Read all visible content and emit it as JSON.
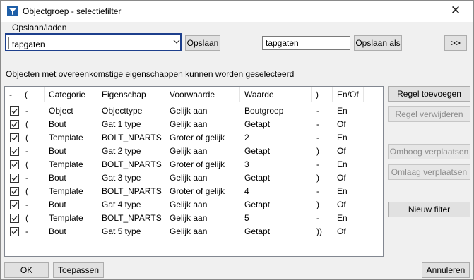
{
  "window": {
    "title": "Objectgroep - selectiefilter",
    "close_glyph": "✕"
  },
  "save_load": {
    "group_label": "Opslaan/laden",
    "combo_value": "tapgaten",
    "save_label": "Opslaan",
    "save_as_value": "tapgaten",
    "save_as_label": "Opslaan als",
    "more_label": ">>"
  },
  "info_text": "Objecten met overeenkomstige eigenschappen kunnen worden geselecteerd",
  "table": {
    "headers": [
      "-",
      "(",
      "Categorie",
      "Eigenschap",
      "Voorwaarde",
      "Waarde",
      ")",
      "En/Of"
    ],
    "rows": [
      {
        "checked": true,
        "dash": "-",
        "open": "-",
        "categorie": "Object",
        "eigenschap": "Objecttype",
        "voorwaarde": "Gelijk aan",
        "waarde": "Boutgroep",
        "close": "-",
        "enof": "En"
      },
      {
        "checked": true,
        "dash": "-",
        "open": "(",
        "categorie": "Bout",
        "eigenschap": "Gat 1 type",
        "voorwaarde": "Gelijk aan",
        "waarde": "Getapt",
        "close": "-",
        "enof": "Of"
      },
      {
        "checked": true,
        "dash": "-",
        "open": "(",
        "categorie": "Template",
        "eigenschap": "BOLT_NPARTS",
        "voorwaarde": "Groter of gelijk",
        "waarde": "2",
        "close": "-",
        "enof": "En"
      },
      {
        "checked": true,
        "dash": "-",
        "open": "-",
        "categorie": "Bout",
        "eigenschap": "Gat 2 type",
        "voorwaarde": "Gelijk aan",
        "waarde": "Getapt",
        "close": ")",
        "enof": "Of"
      },
      {
        "checked": true,
        "dash": "-",
        "open": "(",
        "categorie": "Template",
        "eigenschap": "BOLT_NPARTS",
        "voorwaarde": "Groter of gelijk",
        "waarde": "3",
        "close": "-",
        "enof": "En"
      },
      {
        "checked": true,
        "dash": "-",
        "open": "-",
        "categorie": "Bout",
        "eigenschap": "Gat 3 type",
        "voorwaarde": "Gelijk aan",
        "waarde": "Getapt",
        "close": ")",
        "enof": "Of"
      },
      {
        "checked": true,
        "dash": "-",
        "open": "(",
        "categorie": "Template",
        "eigenschap": "BOLT_NPARTS",
        "voorwaarde": "Groter of gelijk",
        "waarde": "4",
        "close": "-",
        "enof": "En"
      },
      {
        "checked": true,
        "dash": "-",
        "open": "-",
        "categorie": "Bout",
        "eigenschap": "Gat 4 type",
        "voorwaarde": "Gelijk aan",
        "waarde": "Getapt",
        "close": ")",
        "enof": "Of"
      },
      {
        "checked": true,
        "dash": "-",
        "open": "(",
        "categorie": "Template",
        "eigenschap": "BOLT_NPARTS",
        "voorwaarde": "Gelijk aan",
        "waarde": "5",
        "close": "-",
        "enof": "En"
      },
      {
        "checked": true,
        "dash": "-",
        "open": "-",
        "categorie": "Bout",
        "eigenschap": "Gat 5 type",
        "voorwaarde": "Gelijk aan",
        "waarde": "Getapt",
        "close": "))",
        "enof": "Of"
      }
    ]
  },
  "side_buttons": {
    "add_rule": "Regel toevoegen",
    "remove_rule": "Regel verwijderen",
    "move_up": "Omhoog verplaatsen",
    "move_down": "Omlaag verplaatsen",
    "new_filter": "Nieuw filter"
  },
  "footer": {
    "ok": "OK",
    "apply": "Toepassen",
    "cancel": "Annuleren"
  },
  "colors": {
    "focus_border": "#1d3f8c",
    "window_bg": "#f0f0f0",
    "button_bg": "#e1e1e1"
  },
  "icons": {
    "app": "filter-app-icon",
    "close": "close-icon",
    "dropdown": "chevron-down-icon",
    "checkbox": "checkmark-icon"
  }
}
